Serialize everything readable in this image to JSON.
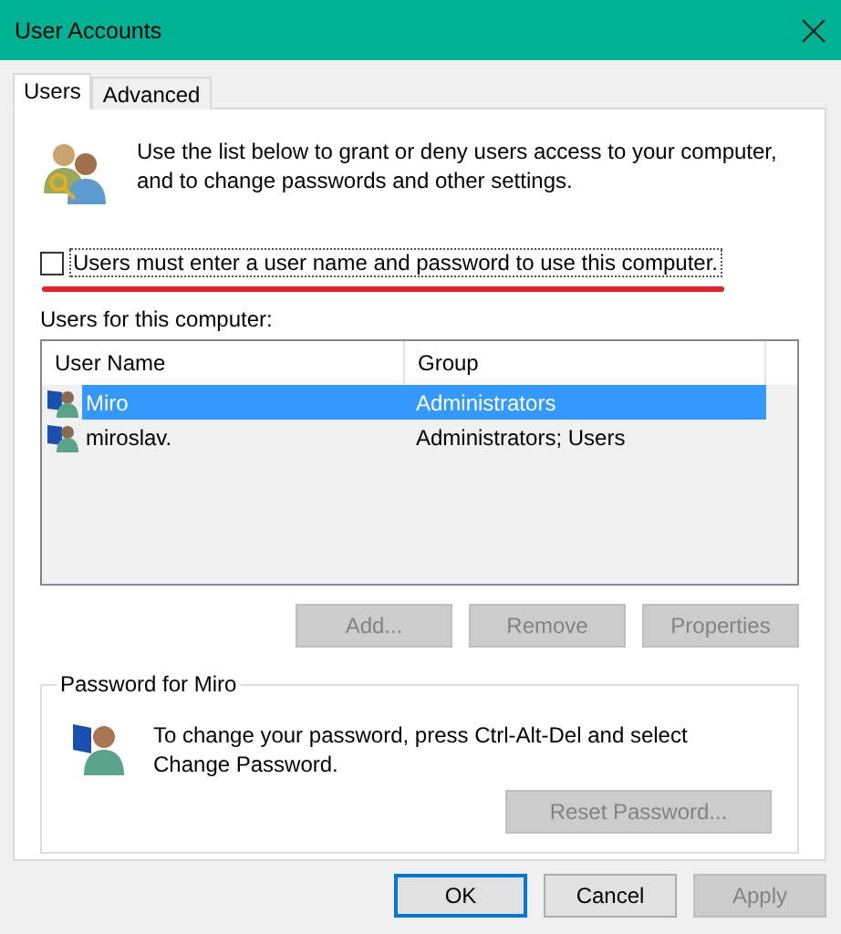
{
  "window": {
    "title": "User Accounts"
  },
  "tabs": [
    {
      "label": "Users",
      "selected": true
    },
    {
      "label": "Advanced",
      "selected": false
    }
  ],
  "intro": "Use the list below to grant or deny users access to your computer, and to change passwords and other settings.",
  "require_login": {
    "label": "Users must enter a user name and password to use this computer.",
    "checked": false,
    "focused": true
  },
  "users_label": "Users for this computer:",
  "users_table": {
    "columns": [
      "User Name",
      "Group"
    ],
    "rows": [
      {
        "user_name": "Miro",
        "group": "Administrators",
        "selected": true
      },
      {
        "user_name": "miroslav.",
        "group": "Administrators; Users",
        "selected": false
      }
    ]
  },
  "list_buttons": [
    {
      "label": "Add...",
      "disabled": true
    },
    {
      "label": "Remove",
      "disabled": true
    },
    {
      "label": "Properties",
      "disabled": true
    }
  ],
  "password_group": {
    "title": "Password for Miro",
    "text": "To change your password, press Ctrl-Alt-Del and select Change Password.",
    "button": {
      "label": "Reset Password...",
      "disabled": true
    }
  },
  "dialog_buttons": [
    {
      "label": "OK",
      "default": true,
      "disabled": false
    },
    {
      "label": "Cancel",
      "default": false,
      "disabled": false
    },
    {
      "label": "Apply",
      "default": false,
      "disabled": true
    }
  ]
}
